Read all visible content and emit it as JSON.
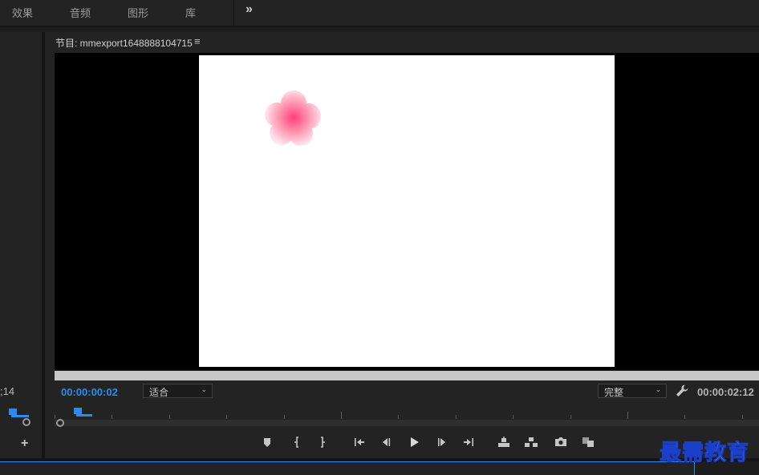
{
  "top_tabs": [
    {
      "label": "效果"
    },
    {
      "label": "音频"
    },
    {
      "label": "图形"
    },
    {
      "label": "库"
    }
  ],
  "overflow_symbol": "»",
  "source_panel": {
    "timecode": ";14",
    "add_symbol": "+"
  },
  "program_monitor": {
    "title": "节目: mmexport1648888104715",
    "menu_symbol": "≡",
    "current_timecode": "00:00:00:02",
    "zoom_value": "适合",
    "quality_value": "完整",
    "duration_timecode": "00:00:02:12",
    "playhead_fraction": 0.011
  },
  "transport": [
    {
      "name": "add-marker",
      "icon": "marker-icon"
    },
    {
      "name": "mark-in",
      "icon": "mark-in-icon"
    },
    {
      "name": "mark-out",
      "icon": "mark-out-icon"
    },
    {
      "name": "go-to-in",
      "icon": "go-to-in-icon"
    },
    {
      "name": "step-back",
      "icon": "step-back-icon"
    },
    {
      "name": "play",
      "icon": "play-icon"
    },
    {
      "name": "step-forward",
      "icon": "step-forward-icon"
    },
    {
      "name": "go-to-out",
      "icon": "go-to-out-icon"
    },
    {
      "name": "lift",
      "icon": "lift-icon"
    },
    {
      "name": "extract",
      "icon": "extract-icon"
    },
    {
      "name": "export-frame",
      "icon": "camera-icon"
    },
    {
      "name": "compare",
      "icon": "compare-icon"
    }
  ],
  "watermark": "最需教育",
  "colors": {
    "accent": "#2d8ceb",
    "panel": "#232323",
    "viewer_bg": "#000000",
    "frame_bg": "#ffffff",
    "flower": "#ff3f78"
  }
}
